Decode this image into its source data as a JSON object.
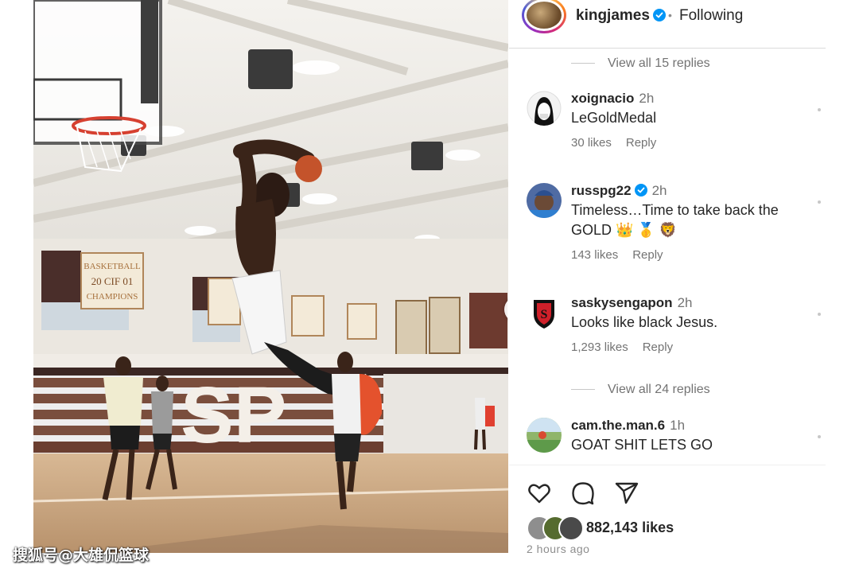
{
  "post": {
    "author": "kingjames",
    "separator": "•",
    "follow_state": "Following",
    "verified_color": "#0095f6"
  },
  "photo": {
    "banner_1": [
      "BASKETBALL",
      "20 CIF 01",
      "CHAMPIONS"
    ],
    "floor_letters": "SP",
    "next_icon": "chevron-right-icon"
  },
  "watermark": "搜狐号@大雄侃篮球",
  "thread": {
    "view_replies_1": "View all 15 replies",
    "view_replies_2": "View all 24 replies"
  },
  "comments": [
    {
      "user": "xoignacio",
      "time": "2h",
      "text": "LeGoldMedal",
      "likes": "30 likes",
      "reply": "Reply",
      "verified": false
    },
    {
      "user": "russpg22",
      "time": "2h",
      "text": "Timeless…Time to take back the GOLD 👑 🥇 🦁",
      "likes": "143 likes",
      "reply": "Reply",
      "verified": true
    },
    {
      "user": "saskysengapon",
      "time": "2h",
      "text": "Looks like black Jesus.",
      "likes": "1,293 likes",
      "reply": "Reply",
      "verified": false
    },
    {
      "user": "cam.the.man.6",
      "time": "1h",
      "text": "GOAT SHIT LETS GO",
      "verified": false
    }
  ],
  "actions": {
    "like_icon": "heart-icon",
    "comment_icon": "comment-icon",
    "share_icon": "share-icon"
  },
  "likes_total": "882,143 likes",
  "posted_ago": "2 hours ago"
}
